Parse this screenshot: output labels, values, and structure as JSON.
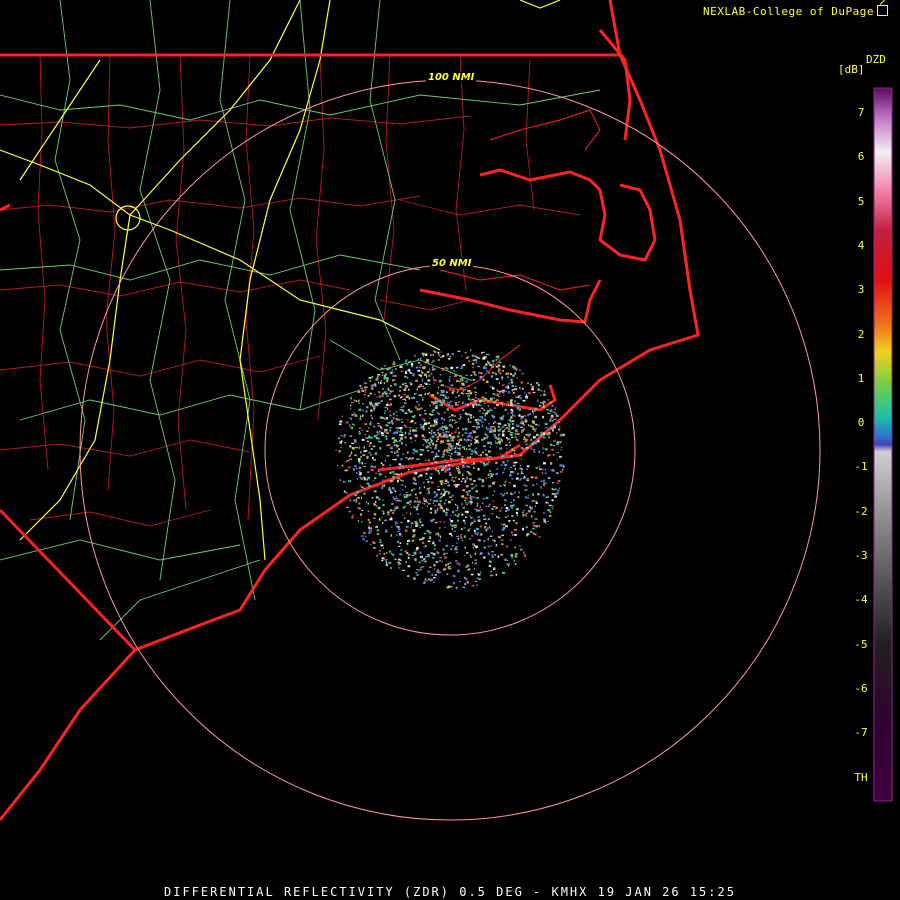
{
  "credit": {
    "text": "NEXLAB-College of DuPage",
    "icon": "external-link-icon"
  },
  "caption": "DIFFERENTIAL REFLECTIVITY (ZDR) 0.5 DEG - KMHX 19 JAN 26 15:25",
  "legend": {
    "product": "DZD",
    "unit": "[dB]",
    "ticks": [
      "7",
      "6",
      "5",
      "4",
      "3",
      "2",
      "1",
      "0",
      "-1",
      "-2",
      "-3",
      "-4",
      "-5",
      "-6",
      "-7",
      "TH"
    ]
  },
  "range_rings": [
    {
      "label": "50 NMI",
      "nmi": 50
    },
    {
      "label": "100 NMI",
      "nmi": 100
    }
  ],
  "colors": {
    "background": "#000000",
    "state_border": "#ff2020",
    "county": "#c02020",
    "highway": "#66cc66",
    "interstate": "#ffff44",
    "range_ring": "#ff9999",
    "text": "#ffff3a"
  }
}
